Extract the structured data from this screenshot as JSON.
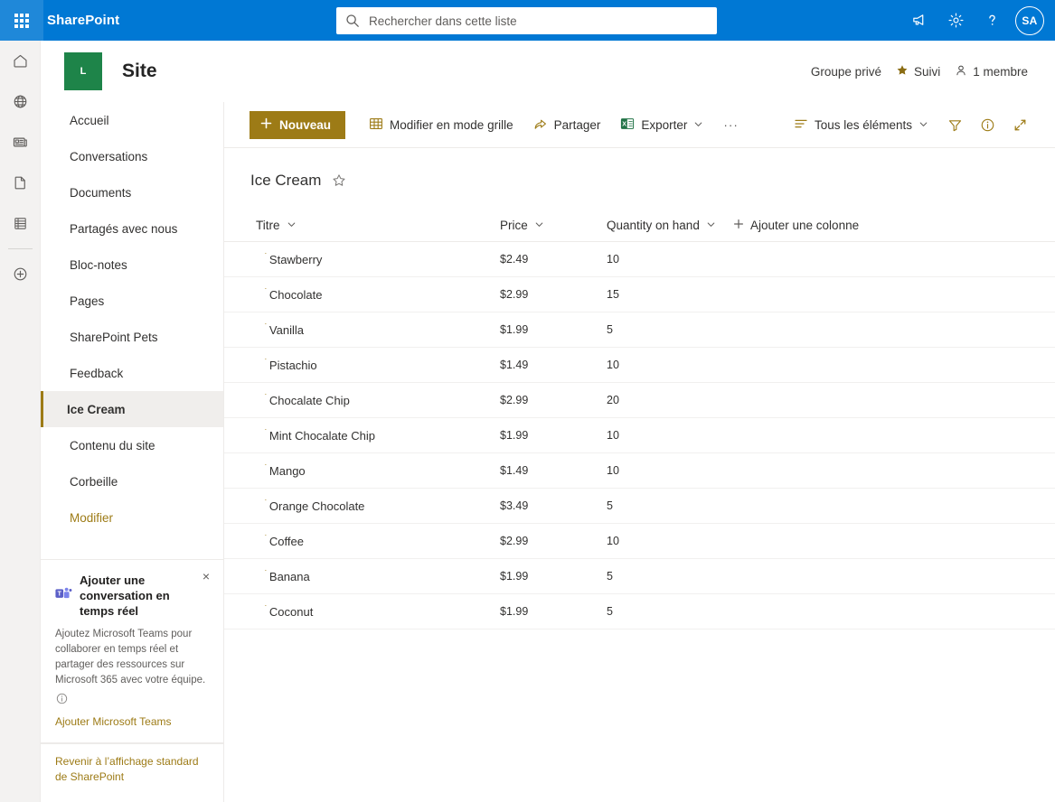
{
  "suite": {
    "waffle_label": "app-launcher",
    "brand": "SharePoint",
    "search_placeholder": "Rechercher dans cette liste",
    "search_value": "",
    "avatar_initials": "SA",
    "icons": [
      "megaphone-icon",
      "gear-icon",
      "help-icon"
    ]
  },
  "app_rail": {
    "items": [
      {
        "name": "home-icon"
      },
      {
        "name": "globe-icon"
      },
      {
        "name": "news-icon"
      },
      {
        "name": "page-icon"
      },
      {
        "name": "lists-icon"
      },
      {
        "name": "create-icon"
      }
    ]
  },
  "site_header": {
    "logo_letter": "L",
    "title": "Site",
    "privacy": "Groupe privé",
    "follow_label": "Suivi",
    "members_label": "1 membre"
  },
  "left_nav": {
    "items": [
      {
        "label": "Accueil",
        "selected": false
      },
      {
        "label": "Conversations",
        "selected": false
      },
      {
        "label": "Documents",
        "selected": false
      },
      {
        "label": "Partagés avec nous",
        "selected": false
      },
      {
        "label": "Bloc-notes",
        "selected": false
      },
      {
        "label": "Pages",
        "selected": false
      },
      {
        "label": "SharePoint Pets",
        "selected": false
      },
      {
        "label": "Feedback",
        "selected": false
      },
      {
        "label": "Ice Cream",
        "selected": true
      },
      {
        "label": "Contenu du site",
        "selected": false
      },
      {
        "label": "Corbeille",
        "selected": false
      },
      {
        "label": "Modifier",
        "selected": false,
        "accent": true
      }
    ]
  },
  "teams_promo": {
    "title": "Ajouter une conversation en temps réel",
    "body": "Ajoutez Microsoft Teams pour collaborer en temps réel et partager des ressources sur Microsoft 365 avec votre équipe.",
    "link": "Ajouter Microsoft Teams",
    "close_label": "×"
  },
  "nav_footer": {
    "link": "Revenir à l’affichage standard de SharePoint"
  },
  "command_bar": {
    "new_label": "Nouveau",
    "grid_edit_label": "Modifier en mode grille",
    "share_label": "Partager",
    "export_label": "Exporter",
    "overflow_label": "···",
    "view_label": "Tous les éléments",
    "filter_name": "filter-icon",
    "info_name": "info-icon",
    "expand_name": "expand-icon"
  },
  "list": {
    "title": "Ice Cream",
    "favorite_name": "star-outline-icon",
    "add_column_label": "Ajouter une colonne",
    "columns": [
      {
        "label": "Titre"
      },
      {
        "label": "Price"
      },
      {
        "label": "Quantity on hand"
      }
    ],
    "rows": [
      {
        "title": "Stawberry",
        "price": "$2.49",
        "qty": "10"
      },
      {
        "title": "Chocolate",
        "price": "$2.99",
        "qty": "15"
      },
      {
        "title": "Vanilla",
        "price": "$1.99",
        "qty": "5"
      },
      {
        "title": "Pistachio",
        "price": "$1.49",
        "qty": "10"
      },
      {
        "title": "Chocalate Chip",
        "price": "$2.99",
        "qty": "20"
      },
      {
        "title": "Mint Chocalate Chip",
        "price": "$1.99",
        "qty": "10"
      },
      {
        "title": "Mango",
        "price": "$1.49",
        "qty": "10"
      },
      {
        "title": "Orange Chocolate",
        "price": "$3.49",
        "qty": "5"
      },
      {
        "title": "Coffee",
        "price": "$2.99",
        "qty": "10"
      },
      {
        "title": "Banana",
        "price": "$1.99",
        "qty": "5"
      },
      {
        "title": "Coconut",
        "price": "$1.99",
        "qty": "5"
      }
    ]
  },
  "colors": {
    "suite_blue": "#0078d4",
    "accent_gold": "#9d7b16",
    "site_logo_green": "#1e8449",
    "excel_green": "#217346",
    "teams_purple": "#5b5fc7"
  }
}
